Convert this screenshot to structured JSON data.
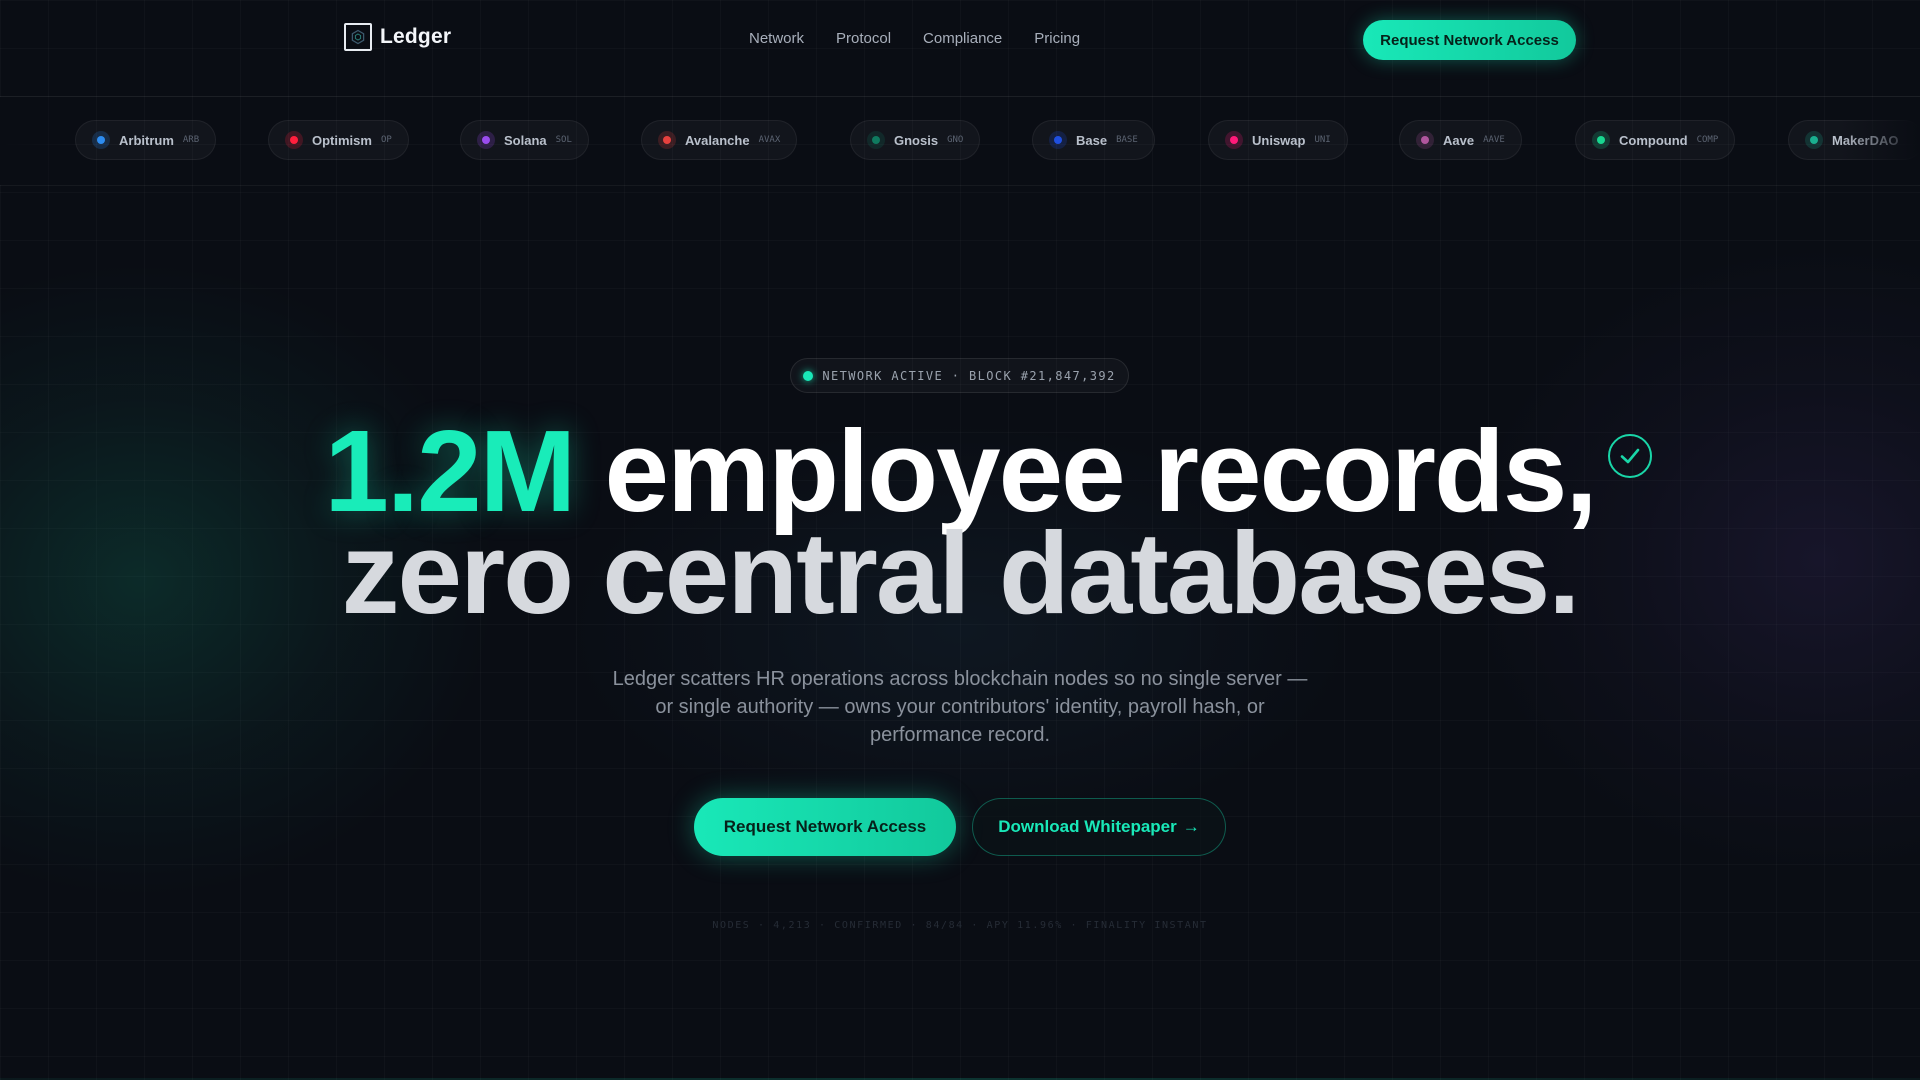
{
  "brand": {
    "name": "Ledger",
    "accent": "#19e8b8",
    "logo_icon": "hexagon-icon"
  },
  "nav": {
    "links": [
      "Network",
      "Protocol",
      "Compliance",
      "Pricing"
    ],
    "cta_label": "Request Network Access"
  },
  "ticker": {
    "chains": [
      {
        "name": "Arbitrum",
        "symbol": "ARB",
        "color": "#2d8cf0"
      },
      {
        "name": "Optimism",
        "symbol": "OP",
        "color": "#ff1f3d"
      },
      {
        "name": "Solana",
        "symbol": "SOL",
        "color": "#9a4cf0"
      },
      {
        "name": "Avalanche",
        "symbol": "AVAX",
        "color": "#e8413e"
      },
      {
        "name": "Gnosis",
        "symbol": "GNO",
        "color": "#0f7a5f"
      },
      {
        "name": "Base",
        "symbol": "BASE",
        "color": "#1f4fe0"
      },
      {
        "name": "Uniswap",
        "symbol": "UNI",
        "color": "#ff1a7a"
      },
      {
        "name": "Aave",
        "symbol": "AAVE",
        "color": "#b0569e"
      },
      {
        "name": "Compound",
        "symbol": "COMP",
        "color": "#19d68f"
      },
      {
        "name": "MakerDAO",
        "symbol": "",
        "color": "#1aaf8f"
      }
    ]
  },
  "hero": {
    "status": "NETWORK ACTIVE · BLOCK #21,847,392",
    "headline_accent": "1.2M",
    "headline_line1": "employee records,",
    "headline_line2": "zero central databases.",
    "subtitle": "Ledger scatters HR operations across blockchain nodes so no single server — or single authority — owns your contributors' identity, payroll hash, or performance record.",
    "primary_cta": "Request Network Access",
    "secondary_cta": "Download Whitepaper",
    "secondary_cta_arrow": "→",
    "stats_strip": "NODES · 4,213 · CONFIRMED · 84/84 · APY 11.96% · FINALITY INSTANT"
  }
}
